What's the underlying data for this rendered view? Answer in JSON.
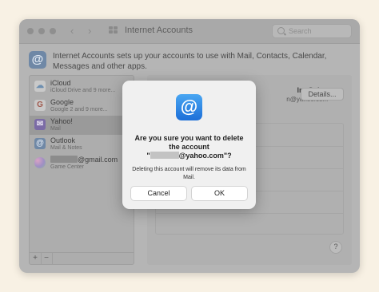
{
  "window": {
    "title": "Internet Accounts",
    "search_placeholder": "Search"
  },
  "header": {
    "description": "Internet Accounts sets up your accounts to use with Mail, Contacts, Calendar, Messages and other apps."
  },
  "accounts": [
    {
      "name": "iCloud",
      "subtitle": "iCloud Drive and 9 more...",
      "icon": "icloud-icon"
    },
    {
      "name": "Google",
      "subtitle": "Google 2 and 9 more...",
      "icon": "google-icon"
    },
    {
      "name": "Yahoo!",
      "subtitle": "Mail",
      "icon": "yahoo-icon",
      "selected": true
    },
    {
      "name": "Outlook",
      "subtitle": "Mail & Notes",
      "icon": "outlook-icon"
    },
    {
      "name": "@gmail.com",
      "subtitle": "Game Center",
      "icon": "game-center-icon"
    }
  ],
  "sidebar_footer": {
    "add": "+",
    "remove": "−"
  },
  "detail": {
    "user_name": "Ira Galen",
    "email": "n@yahoo.com",
    "details_button": "Details...",
    "help": "?"
  },
  "dialog": {
    "title_line1": "Are you sure you want to delete",
    "title_line2": "the account",
    "title_line3_suffix": "@yahoo.com\"?",
    "title_line3_prefix": "\"",
    "message": "Deleting this account will remove its data from Mail.",
    "cancel_label": "Cancel",
    "ok_label": "OK"
  },
  "colors": {
    "accent": "#1d6fd8",
    "backdrop": "#f8f1e4"
  }
}
